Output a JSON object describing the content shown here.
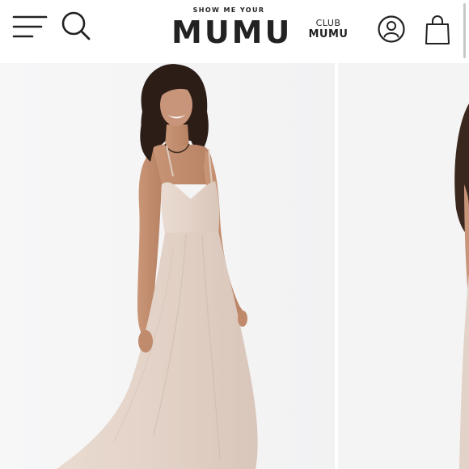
{
  "header": {
    "logo_small": "SHOW ME YOUR",
    "logo_big": "MUMU",
    "club_top": "CLUB",
    "club_bottom": "MUMU",
    "icons": {
      "menu": "menu-icon",
      "search": "search-icon",
      "account": "account-icon",
      "bag": "shopping-bag-icon"
    }
  },
  "gallery": {
    "slides": [
      {
        "content": "product-photo",
        "dress_color": "#e6d6cc"
      },
      {
        "content": "product-photo",
        "dress_color": "#e6d6cc"
      }
    ]
  },
  "colors": {
    "text": "#222222",
    "background": "#ffffff",
    "photo_background": "#f5f5f6"
  }
}
